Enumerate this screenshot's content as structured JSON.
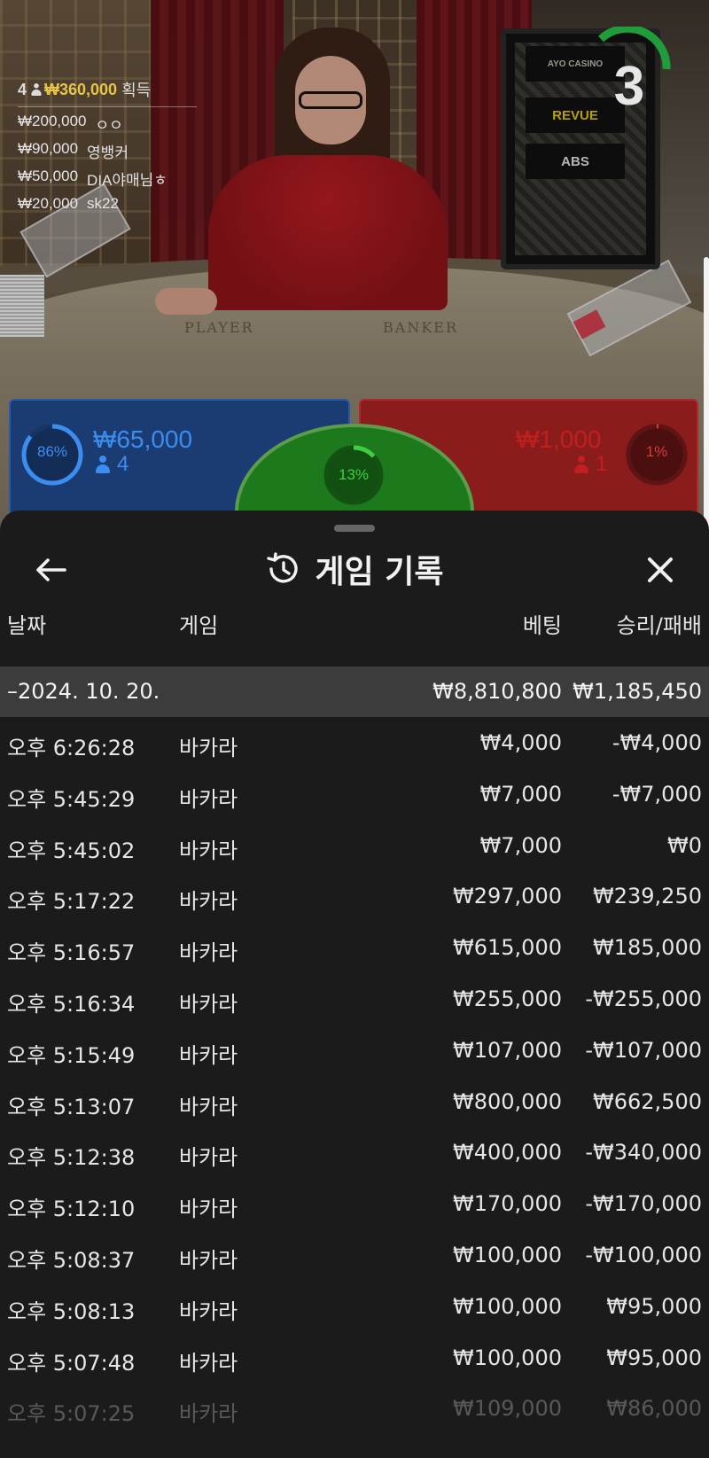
{
  "stream": {
    "countdown": "3",
    "table_labels": {
      "player": "PLAYER",
      "banker": "BANKER"
    },
    "sponsors": [
      "AYO CASINO",
      "REVUE",
      "ABS"
    ],
    "winners": {
      "count": "4",
      "total": "₩360,000",
      "suffix": "획득",
      "list": [
        {
          "amount": "₩200,000",
          "name": "ㅇㅇ"
        },
        {
          "amount": "₩90,000",
          "name": "영뱅커"
        },
        {
          "amount": "₩50,000",
          "name": "DIA야매님ㅎ"
        },
        {
          "amount": "₩20,000",
          "name": "sk22"
        }
      ]
    },
    "bets": {
      "player": {
        "percent": "86%",
        "percent_value": 86,
        "amount": "₩65,000",
        "players": "4",
        "color": "#3c8df0"
      },
      "tie": {
        "percent": "13%",
        "percent_value": 13,
        "color": "#3ecf3e"
      },
      "banker": {
        "percent": "1%",
        "percent_value": 1,
        "amount": "₩1,000",
        "players": "1",
        "color": "#d23c3c"
      }
    }
  },
  "history": {
    "title": "게임 기록",
    "icons": {
      "back": "arrow-left-icon",
      "title": "history-clock-icon",
      "close": "close-icon"
    },
    "columns": {
      "date": "날짜",
      "game": "게임",
      "bet": "베팅",
      "result": "승리/패배"
    },
    "day": {
      "date": "–2024. 10. 20.",
      "bet": "₩8,810,800",
      "result": "₩1,185,450"
    },
    "rows": [
      {
        "time": "오후 6:26:28",
        "game": "바카라",
        "bet": "₩4,000",
        "result": "-₩4,000"
      },
      {
        "time": "오후 5:45:29",
        "game": "바카라",
        "bet": "₩7,000",
        "result": "-₩7,000"
      },
      {
        "time": "오후 5:45:02",
        "game": "바카라",
        "bet": "₩7,000",
        "result": "₩0"
      },
      {
        "time": "오후 5:17:22",
        "game": "바카라",
        "bet": "₩297,000",
        "result": "₩239,250"
      },
      {
        "time": "오후 5:16:57",
        "game": "바카라",
        "bet": "₩615,000",
        "result": "₩185,000"
      },
      {
        "time": "오후 5:16:34",
        "game": "바카라",
        "bet": "₩255,000",
        "result": "-₩255,000"
      },
      {
        "time": "오후 5:15:49",
        "game": "바카라",
        "bet": "₩107,000",
        "result": "-₩107,000"
      },
      {
        "time": "오후 5:13:07",
        "game": "바카라",
        "bet": "₩800,000",
        "result": "₩662,500"
      },
      {
        "time": "오후 5:12:38",
        "game": "바카라",
        "bet": "₩400,000",
        "result": "-₩340,000"
      },
      {
        "time": "오후 5:12:10",
        "game": "바카라",
        "bet": "₩170,000",
        "result": "-₩170,000"
      },
      {
        "time": "오후 5:08:37",
        "game": "바카라",
        "bet": "₩100,000",
        "result": "-₩100,000"
      },
      {
        "time": "오후 5:08:13",
        "game": "바카라",
        "bet": "₩100,000",
        "result": "₩95,000"
      },
      {
        "time": "오후 5:07:48",
        "game": "바카라",
        "bet": "₩100,000",
        "result": "₩95,000"
      },
      {
        "time": "오후 5:07:25",
        "game": "바카라",
        "bet": "₩109,000",
        "result": "₩86,000"
      }
    ]
  }
}
